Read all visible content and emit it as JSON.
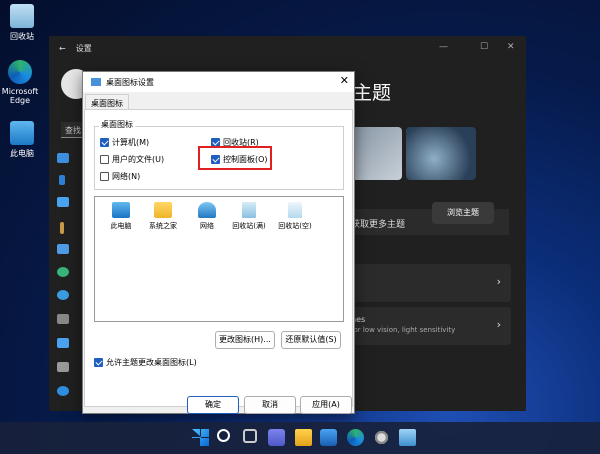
{
  "desktop": {
    "recycle_bin": "回收站",
    "edge": "Microsoft Edge",
    "this_pc": "此电脑"
  },
  "settings": {
    "title": "设置",
    "back": "←",
    "search_stub": "查找",
    "heading": "主题",
    "get_more": "获取更多主题",
    "browse": "浏览主题",
    "row2_label": "nes",
    "row2_sub": "for low vision, light sensitivity",
    "chevron": "›"
  },
  "dialog": {
    "title": "桌面图标设置",
    "close": "✕",
    "tab": "桌面图标",
    "group_label": "桌面图标",
    "checkboxes": {
      "computer": {
        "label": "计算机(M)",
        "checked": true
      },
      "recycle": {
        "label": "回收站(R)",
        "checked": true
      },
      "user_files": {
        "label": "用户的文件(U)",
        "checked": false
      },
      "control_panel": {
        "label": "控制面板(O)",
        "checked": true
      },
      "network": {
        "label": "网络(N)",
        "checked": false
      }
    },
    "icons": [
      "此电脑",
      "系统之家",
      "网络",
      "回收站(满)",
      "回收站(空)"
    ],
    "change_icon": "更改图标(H)...",
    "restore_default": "还原默认值(S)",
    "allow_themes": {
      "label": "允许主题更改桌面图标(L)",
      "checked": true
    },
    "ok": "确定",
    "cancel": "取消",
    "apply": "应用(A)"
  },
  "colors": {
    "accent": "#1f5fbf",
    "highlight": "#e02020"
  }
}
